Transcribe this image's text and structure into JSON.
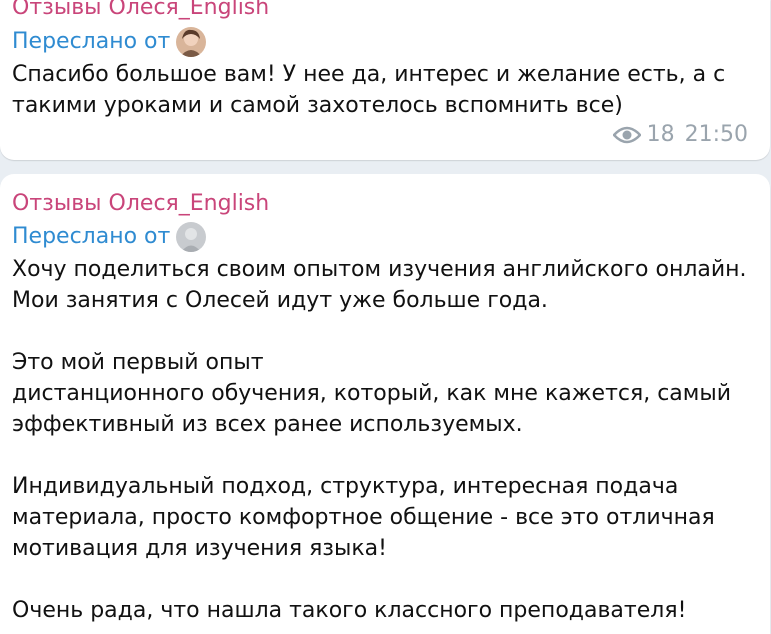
{
  "messages": [
    {
      "sender": "Отзывы Олеся_English",
      "forwarded_label": "Переслано от",
      "avatar_icon": "user-avatar-photo",
      "text": "Спасибо большое вам! У нее да, интерес и желание есть, а с\nтакими уроками и самой захотелось вспомнить все)",
      "views": "18",
      "time": "21:50"
    },
    {
      "sender": "Отзывы Олеся_English",
      "forwarded_label": "Переслано от",
      "avatar_icon": "user-avatar-gray",
      "text": "Хочу поделиться своим опытом изучения английского онлайн.\nМои занятия с Олесей идут уже больше года.\n\nЭто мой первый опыт\nдистанционного обучения, который, как мне кажется,  самый\nэффективный из всех ранее используемых.\n\nИндивидуальный подход, структура, интересная подача\nматериала, просто комфортное общение - все это отличная\nмотивация для изучения языка!\n\nОчень рада, что нашла такого классного преподавателя!"
    }
  ],
  "colors": {
    "sender": "#c9457a",
    "forwarded": "#2f8bd1",
    "meta": "#9aa4ad",
    "background": "#e9eef3",
    "bubble": "#ffffff"
  },
  "icons": {
    "views": "eye-icon"
  }
}
